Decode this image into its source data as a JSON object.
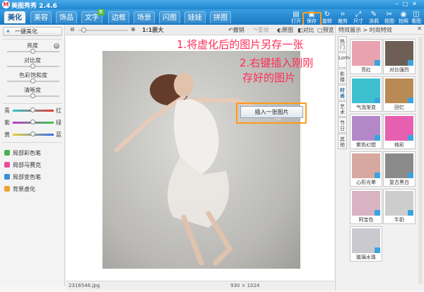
{
  "title": {
    "app_name": "美图秀秀 2.4.6",
    "user": "",
    "user2": ""
  },
  "tabs": [
    {
      "label": "美化",
      "active": true
    },
    {
      "label": "美容",
      "active": false
    },
    {
      "label": "饰品",
      "active": false
    },
    {
      "label": "文字",
      "active": false,
      "badge": "新"
    },
    {
      "label": "边框",
      "active": false
    },
    {
      "label": "场景",
      "active": false
    },
    {
      "label": "闪图",
      "active": false
    },
    {
      "label": "娃娃",
      "active": false
    },
    {
      "label": "拼图",
      "active": false
    }
  ],
  "right_tools": [
    {
      "label": "打开",
      "icon": "folder-icon"
    },
    {
      "label": "保存",
      "icon": "save-icon"
    },
    {
      "label": "旋转",
      "icon": "rotate-icon"
    },
    {
      "label": "裁剪",
      "icon": "crop-icon"
    },
    {
      "label": "尺寸",
      "icon": "resize-icon"
    },
    {
      "label": "涂鸦",
      "icon": "pen-icon"
    },
    {
      "label": "抠图",
      "icon": "scissors-icon"
    },
    {
      "label": "拍照",
      "icon": "camera-icon"
    },
    {
      "label": "看图",
      "icon": "view-icon"
    }
  ],
  "sidebar": {
    "onekey_label": "一键美化",
    "sliders": [
      {
        "label": "亮度",
        "value": 0.5
      },
      {
        "label": "对比度",
        "value": 0.5
      },
      {
        "label": "色彩饱和度",
        "value": 0.5
      },
      {
        "label": "清晰度",
        "value": 0.5
      }
    ],
    "color_sliders": [
      {
        "left": "青",
        "right": "红",
        "value": 0.5
      },
      {
        "left": "紫",
        "right": "绿",
        "value": 0.5
      },
      {
        "left": "黄",
        "right": "蓝",
        "value": 0.5
      }
    ],
    "links": [
      {
        "label": "局部彩色笔",
        "color": "#4caf50"
      },
      {
        "label": "局部马赛克",
        "color": "#e84c9a"
      },
      {
        "label": "局部变色笔",
        "color": "#3a8fd8"
      },
      {
        "label": "背景虚化",
        "color": "#f0a030"
      }
    ]
  },
  "edit_toolbar": {
    "zoom_label": "1:1原大",
    "undo": "撤销",
    "redo": "重做",
    "original": "原图",
    "compare": "对比",
    "preview": "预览"
  },
  "status": {
    "filename": "2316546.jpg",
    "dims": "930 × 1024"
  },
  "annotations": {
    "step1": "1.将虚化后的图片另存一张",
    "step2": "2.右键插入刚刚",
    "step3": "存好的图片"
  },
  "context_menu": {
    "item": "插入一张图片"
  },
  "right_panel": {
    "breadcrumb": "特效展示 > 时尚特效",
    "vtabs": [
      "热门",
      "Lomo",
      "影楼",
      "时尚",
      "艺术",
      "节日",
      "其他"
    ],
    "active_vtab": "时尚",
    "effects": [
      {
        "label": "亮红",
        "color": "#e8a2b0"
      },
      {
        "label": "对比强烈",
        "color": "#6d5f55"
      },
      {
        "label": "气泡渐变",
        "color": "#3fc0d0"
      },
      {
        "label": "回忆",
        "color": "#b98a54"
      },
      {
        "label": "紫色幻想",
        "color": "#b487c8"
      },
      {
        "label": "纯彩",
        "color": "#e75fb0"
      },
      {
        "label": "心形光晕",
        "color": "#d6a8a0"
      },
      {
        "label": "复古黑白",
        "color": "#8a8a8a"
      },
      {
        "label": "阿宝色",
        "color": "#d9b3c2"
      },
      {
        "label": "牛奶",
        "color": "#cdcdcd"
      },
      {
        "label": "玻璃水珠",
        "color": "#c9c9cf"
      }
    ]
  }
}
